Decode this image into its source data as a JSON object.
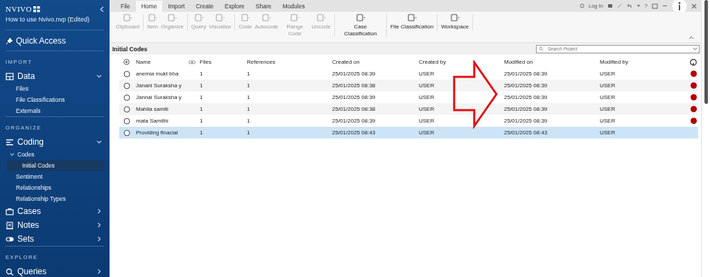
{
  "app": {
    "logo": "NVIVO",
    "project": "How to use Nvivo.nvp (Edited)"
  },
  "sidebar": {
    "quick_access": "Quick Access",
    "sections": [
      {
        "heading": "IMPORT",
        "groups": [
          {
            "label": "Data",
            "expanded": true,
            "items": [
              {
                "label": "Files",
                "selected": false
              },
              {
                "label": "File Classifications",
                "selected": false
              },
              {
                "label": "Externals",
                "selected": false
              }
            ]
          }
        ]
      },
      {
        "heading": "ORGANIZE",
        "groups": [
          {
            "label": "Coding",
            "expanded": true,
            "items": [
              {
                "label": "Codes",
                "selected": false,
                "expanded": true,
                "children": [
                  {
                    "label": "Initial Codes",
                    "selected": true
                  }
                ]
              },
              {
                "label": "Sentiment",
                "selected": false
              },
              {
                "label": "Relationships",
                "selected": false
              },
              {
                "label": "Relationship Types",
                "selected": false
              }
            ]
          },
          {
            "label": "Cases",
            "expanded": false
          },
          {
            "label": "Notes",
            "expanded": false
          },
          {
            "label": "Sets",
            "expanded": false
          }
        ]
      },
      {
        "heading": "EXPLORE",
        "groups": [
          {
            "label": "Queries",
            "expanded": false
          }
        ]
      }
    ]
  },
  "menu_tabs": [
    {
      "label": "File",
      "selected": false
    },
    {
      "label": "Home",
      "selected": true
    },
    {
      "label": "Import",
      "selected": false
    },
    {
      "label": "Create",
      "selected": false
    },
    {
      "label": "Explore",
      "selected": false
    },
    {
      "label": "Share",
      "selected": false
    },
    {
      "label": "Modules",
      "selected": false
    }
  ],
  "title_bar": {
    "login": "Log In",
    "help": "?"
  },
  "ribbon": [
    [
      {
        "label": "Clipboard",
        "disabled": true
      }
    ],
    [
      {
        "label": "Item",
        "disabled": true
      },
      {
        "label": "Organize",
        "disabled": true
      }
    ],
    [
      {
        "label": "Query",
        "disabled": true
      },
      {
        "label": "Visualize",
        "disabled": true
      }
    ],
    [
      {
        "label": "Code",
        "disabled": true
      },
      {
        "label": "Autocode",
        "disabled": true
      },
      {
        "label": "Range Code",
        "disabled": true
      },
      {
        "label": "Uncode",
        "disabled": true
      }
    ],
    [
      {
        "label": "Case Classification",
        "disabled": false
      }
    ],
    [
      {
        "label": "File Classification",
        "disabled": false
      }
    ],
    [
      {
        "label": "Workspace",
        "disabled": false
      }
    ]
  ],
  "list": {
    "title": "Initial Codes",
    "search": {
      "placeholder": "Search Project"
    },
    "columns": [
      "Name",
      "Files",
      "References",
      "Created on",
      "Created by",
      "Modified on",
      "Modified by"
    ],
    "rows": [
      {
        "cells": [
          "anemia mukt bha",
          "1",
          "1",
          "25/01/2025 08:39",
          "USER",
          "25/01/2025 08:39",
          "USER"
        ],
        "color": "#b00000",
        "selected": false
      },
      {
        "cells": [
          "Janani Suraksha y",
          "1",
          "1",
          "25/01/2025 08:38",
          "USER",
          "25/01/2025 08:39",
          "USER"
        ],
        "color": "#b00000",
        "selected": false
      },
      {
        "cells": [
          "Jannai Suraksha y",
          "1",
          "1",
          "25/01/2025 08:39",
          "USER",
          "25/01/2025 08:39",
          "USER"
        ],
        "color": "#b00000",
        "selected": false
      },
      {
        "cells": [
          "Mahila samiti",
          "1",
          "1",
          "25/01/2025 08:38",
          "USER",
          "25/01/2025 08:39",
          "USER"
        ],
        "color": "#b00000",
        "selected": false
      },
      {
        "cells": [
          "mata Samithi",
          "1",
          "1",
          "25/01/2025 08:39",
          "USER",
          "25/01/2025 08:39",
          "USER"
        ],
        "color": "#b00000",
        "selected": false
      },
      {
        "cells": [
          "Providing  finacial",
          "1",
          "1",
          "25/01/2025 08:43",
          "USER",
          "25/01/2025 08:43",
          "USER"
        ],
        "selected": true
      }
    ]
  }
}
